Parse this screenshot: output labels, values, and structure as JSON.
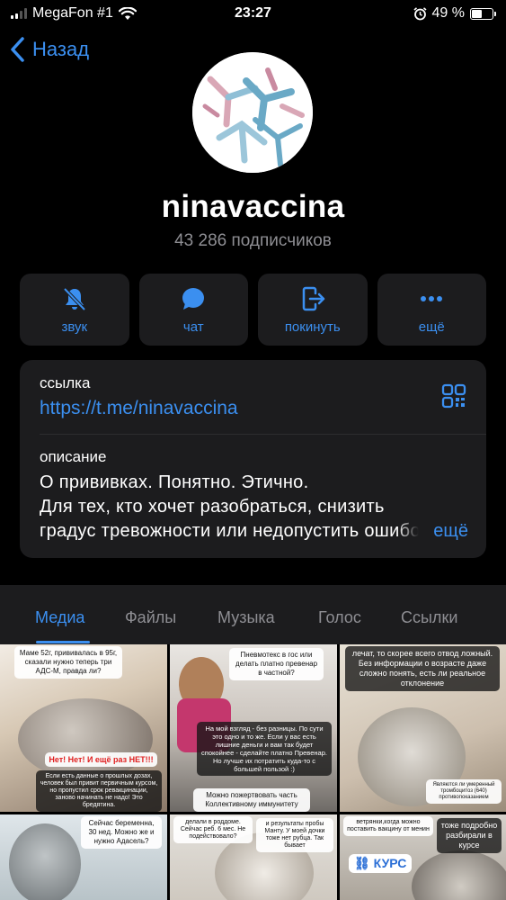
{
  "status_bar": {
    "carrier": "MegaFon #1",
    "time": "23:27",
    "battery": "49 %",
    "battery_level": 0.49
  },
  "nav": {
    "back_label": "Назад"
  },
  "channel": {
    "name": "ninavaccina",
    "subscribers": "43 286 подписчиков"
  },
  "actions": [
    {
      "label": "звук",
      "icon": "bell-slash-icon"
    },
    {
      "label": "чат",
      "icon": "chat-bubble-icon"
    },
    {
      "label": "покинуть",
      "icon": "leave-icon"
    },
    {
      "label": "ещё",
      "icon": "more-dots-icon"
    }
  ],
  "info": {
    "link_label": "ссылка",
    "link": "https://t.me/ninavaccina",
    "description_label": "описание",
    "description_lines": [
      "О прививках. Понятно. Этично.",
      "Для тех, кто хочет разобраться, снизить",
      "градус тревожности или недопустить ошибок"
    ],
    "more": "ещё"
  },
  "tabs": [
    {
      "label": "Медиа",
      "active": true
    },
    {
      "label": "Файлы",
      "active": false
    },
    {
      "label": "Музыка",
      "active": false
    },
    {
      "label": "Голос",
      "active": false
    },
    {
      "label": "Ссылки",
      "active": false
    }
  ],
  "media": {
    "m1_q": "Маме 52г, прививалась в 95г, сказали нужно теперь три АДС-М, правда ли?",
    "m1_a1": "Нет! Нет! И ещё раз НЕТ!!!",
    "m1_a2": "Если есть данные о прошлых дозах, человек был привит первичным курсом, но пропустил срок ревакцинации, заново начинать не надо! Это бредятина.",
    "m2_q": "Пневмотекс в гос или делать платно превенар в частной?",
    "m2_a": "На мой взгляд - без разницы. По сути это одно и то же. Если у вас есть лишние деньги и вам так будет спокойнее - сделайте платно Превенар. Но лучше их потратить куда-то с большей пользой :)",
    "m2_b": "Можно пожертвовать часть Коллективному иммунитету",
    "m3_top": "лечат, то скорее всего отвод ложный. Без информации о возрасте даже сложно понять, есть ли реальное отклонение",
    "m3_q": "Являются ли умеренный тромбоцитоз (640) противопоказанием",
    "m4_q": "Сейчас беременна, 30 нед. Можно же и нужно Адасель?",
    "m5_q": "делали в роддоме. Сейчас реб. 6 мес. Не подействовало?",
    "m5_a": "и результаты пробы Манту. У моей дочки тоже нет рубца. Так бывает",
    "m6_q": "ветрянки,когда можно поставить вакцину от менин",
    "m6_a": "тоже подробно разбирали в курсе",
    "m6_badge": "КУРС"
  },
  "colors": {
    "accent": "#3b8ff0",
    "card_bg": "#1c1c1e",
    "secondary_text": "#8e8e93"
  }
}
